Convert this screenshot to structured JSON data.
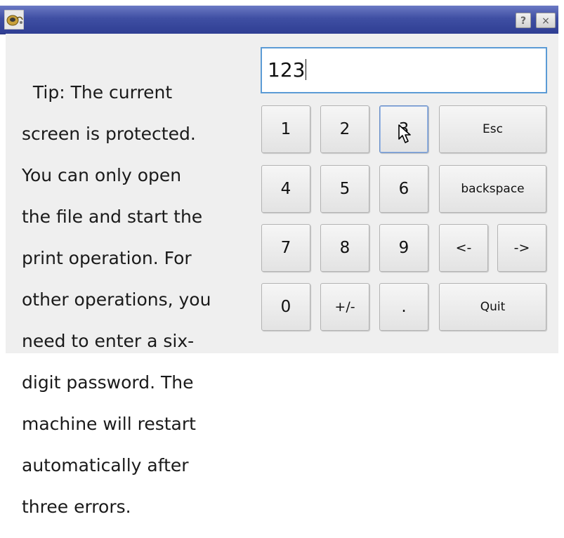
{
  "window": {
    "help_label": "?",
    "close_label": "×"
  },
  "tip": {
    "text": "Tip: The current screen is protected. You can only open the file and start the print operation. For other operations, you need to enter a six-digit password. The machine will restart automatically after three errors.",
    "lines": [
      "  Tip: The current",
      "screen is protected.",
      "You can only open",
      "the file and start the",
      "print operation. For",
      "other operations, you",
      "need to enter a six-",
      "digit password. The",
      "machine will restart",
      "automatically after",
      "three errors."
    ]
  },
  "password_field": {
    "value": "123"
  },
  "keypad": {
    "k1": "1",
    "k2": "2",
    "k3": "3",
    "esc": "Esc",
    "k4": "4",
    "k5": "5",
    "k6": "6",
    "backspace": "backspace",
    "k7": "7",
    "k8": "8",
    "k9": "9",
    "left": "<-",
    "right": "->",
    "k0": "0",
    "sign": "+/-",
    "dot": ".",
    "quit": "Quit"
  }
}
